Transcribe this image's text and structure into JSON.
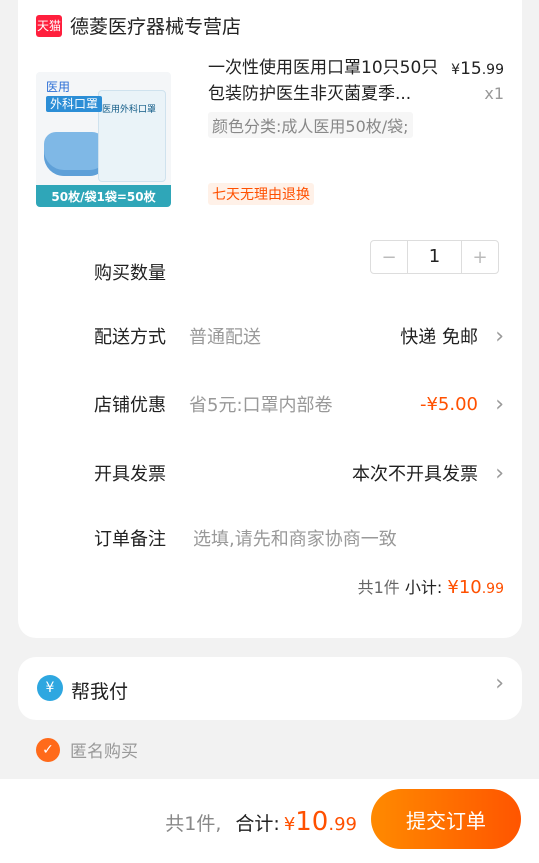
{
  "store": {
    "badge": "天猫",
    "name": "德菱医疗器械专营店"
  },
  "product": {
    "image": {
      "top_label": "医用",
      "top_sub": "外科口罩",
      "bag_title": "医用外科口罩",
      "bottom_label": "50枚/袋1袋=50枚"
    },
    "title": "一次性使用医用口罩10只50只包装防护医生非灭菌夏季...",
    "price_symbol": "¥",
    "price_int": "15",
    "price_dec": ".99",
    "quantity_text": "x1",
    "spec": "颜色分类:成人医用50枚/袋;",
    "return_badge": "七天无理由退换"
  },
  "quantity": {
    "label": "购买数量",
    "value": "1",
    "minus": "−",
    "plus": "+"
  },
  "delivery": {
    "label": "配送方式",
    "hint": "普通配送",
    "value": "快递 免邮"
  },
  "discount": {
    "label": "店铺优惠",
    "hint": "省5元:口罩内部卷",
    "value": "-¥5.00"
  },
  "invoice": {
    "label": "开具发票",
    "value": "本次不开具发票"
  },
  "note": {
    "label": "订单备注",
    "placeholder": "选填,请先和商家协商一致"
  },
  "subtotal": {
    "count": "共1件",
    "label": "小计:",
    "symbol": "¥",
    "int": "10",
    "dec": ".99"
  },
  "help_pay": {
    "icon_char": "¥",
    "label": "帮我付"
  },
  "anonymous": {
    "label": "匿名购买",
    "checked": true
  },
  "bottom": {
    "count": "共1件,",
    "total_label": "合计:",
    "symbol": "¥",
    "int": "10",
    "dec": ".99",
    "submit_label": "提交订单"
  },
  "colors": {
    "accent": "#ff5000",
    "tmall_red": "#ff1f3d",
    "pay_blue": "#2ea7e0"
  }
}
